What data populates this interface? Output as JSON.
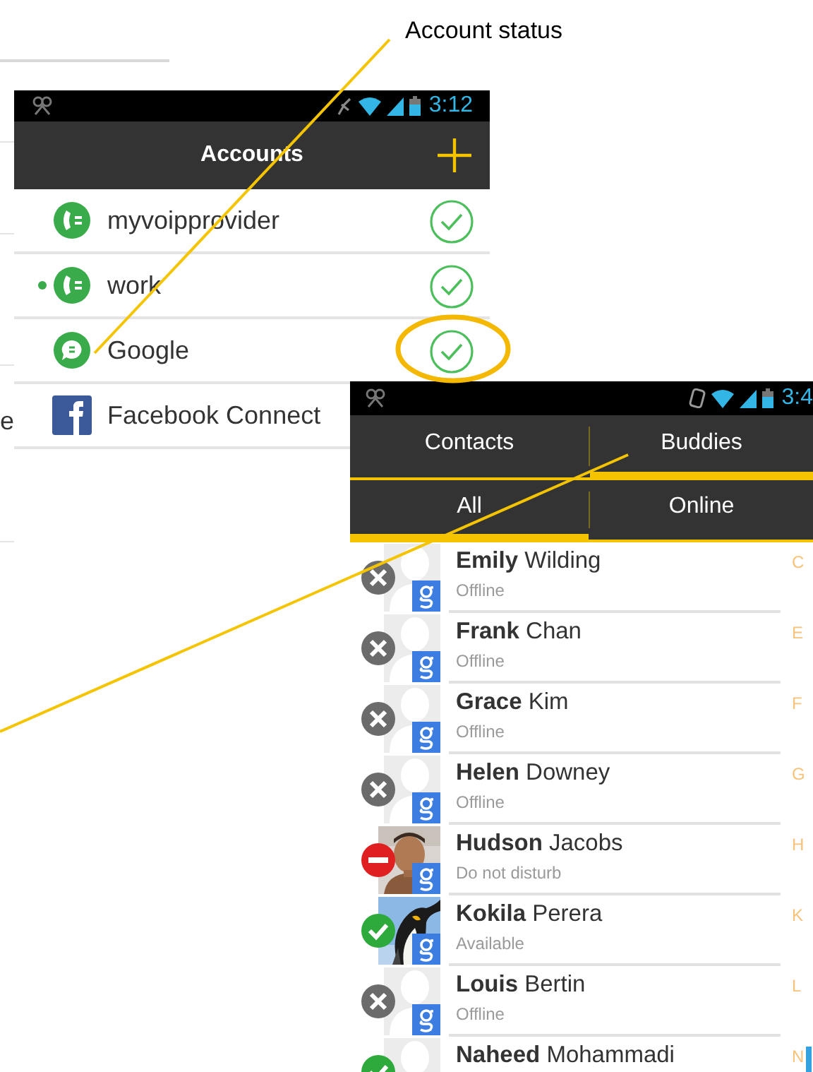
{
  "background_page": {
    "text": "e"
  },
  "annotations": [
    {
      "text": "Account status"
    }
  ],
  "accounts_screen": {
    "status_bar": {
      "time": "3:12"
    },
    "title": "Accounts",
    "accounts": [
      {
        "name": "myvoipprovider",
        "kind": "voip",
        "default": false,
        "connected": true,
        "highlighted": false
      },
      {
        "name": "work",
        "kind": "voip",
        "default": true,
        "connected": true,
        "highlighted": false
      },
      {
        "name": "Google",
        "kind": "chat",
        "default": false,
        "connected": true,
        "highlighted": true
      },
      {
        "name": "Facebook Connect",
        "kind": "facebook",
        "default": false,
        "connected": false,
        "highlighted": false
      }
    ]
  },
  "contacts_screen": {
    "status_bar": {
      "time": "3:4"
    },
    "tabs": [
      {
        "label": "Contacts",
        "selected": false
      },
      {
        "label": "Buddies",
        "selected": true
      }
    ],
    "filters": [
      {
        "label": "All",
        "selected": true
      },
      {
        "label": "Online",
        "selected": false
      }
    ],
    "buddies": [
      {
        "name": "**Emily** Wilding",
        "status_text": "Offline",
        "status_icon": {
          "kind": "offline"
        },
        "avatar": {
          "kind": "placeholder"
        },
        "section": "C"
      },
      {
        "name": "**Frank** Chan",
        "status_text": "Offline",
        "status_icon": {
          "kind": "offline"
        },
        "avatar": {
          "kind": "placeholder"
        },
        "section": "E"
      },
      {
        "name": "**Grace** Kim",
        "status_text": "Offline",
        "status_icon": {
          "kind": "offline"
        },
        "avatar": {
          "kind": "placeholder"
        },
        "section": "F"
      },
      {
        "name": "**Helen** Downey",
        "status_text": "Offline",
        "status_icon": {
          "kind": "offline"
        },
        "avatar": {
          "kind": "placeholder"
        },
        "section": "G"
      },
      {
        "name": "**Hudson** Jacobs",
        "status_text": "Do not disturb",
        "status_icon": {
          "kind": "dnd"
        },
        "section": "H"
      },
      {
        "name": "**Kokila** Perera",
        "status_text": "Available",
        "status_icon": {
          "kind": "available"
        },
        "avatar": {
          "kind": "bird"
        },
        "section": "K"
      },
      {
        "name": "**Louis** Bertin",
        "status_text": "Offline",
        "status_icon": {
          "kind": "offline"
        },
        "avatar": {
          "kind": "placeholder"
        },
        "section": "L"
      },
      {
        "name": "**Naheed** Mohammadi",
        "status_icon": {
          "kind": "available"
        },
        "avatar": {
          "kind": "placeholder",
          "badge_visible": false
        },
        "section": "N"
      }
    ]
  }
}
